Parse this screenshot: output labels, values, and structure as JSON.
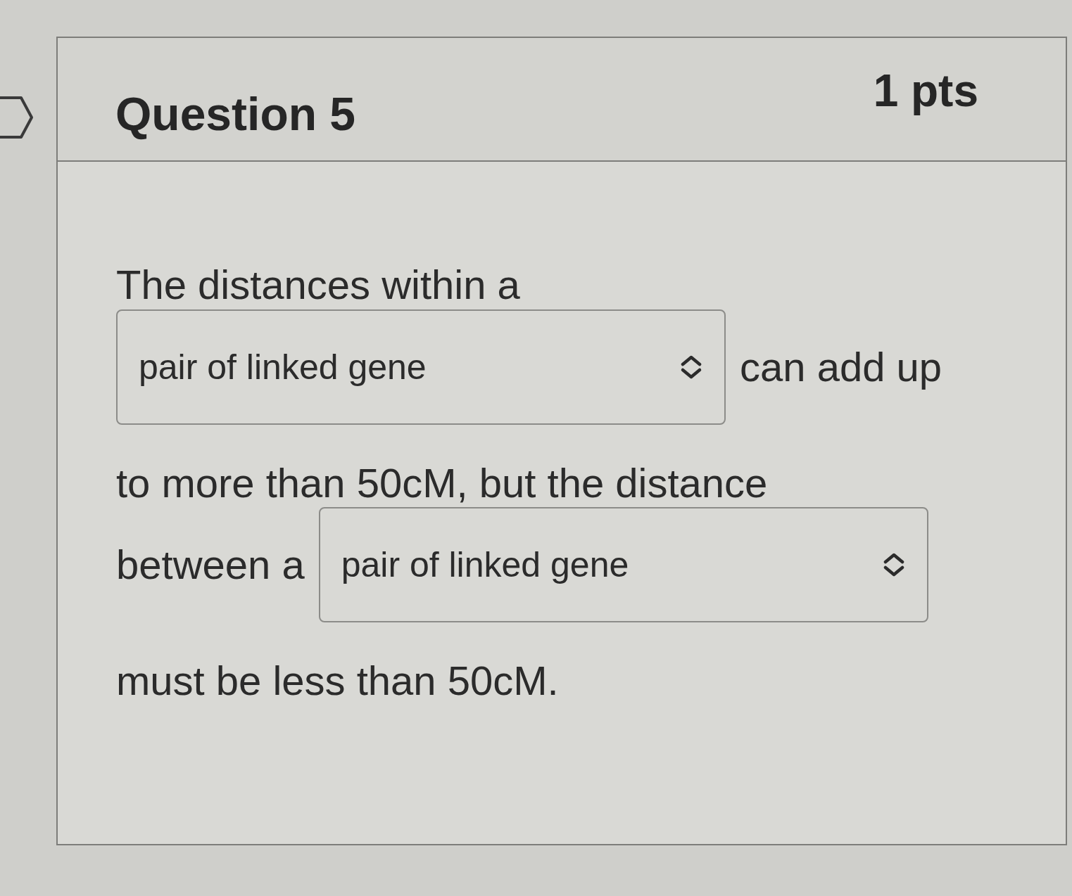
{
  "question": {
    "title": "Question 5",
    "points": "1 pts"
  },
  "lines": [
    [
      {
        "kind": "text",
        "text": "The distances within a"
      }
    ],
    [
      {
        "kind": "dropdown",
        "value": "pair of linked gene"
      },
      {
        "kind": "text",
        "text": "can add up"
      }
    ],
    [
      {
        "kind": "text",
        "text": "to more than 50cM, but the distance"
      }
    ],
    [
      {
        "kind": "text",
        "text": "between a"
      },
      {
        "kind": "dropdown",
        "value": "pair of linked gene"
      }
    ],
    [
      {
        "kind": "text",
        "text": "must be less than 50cM."
      }
    ]
  ]
}
